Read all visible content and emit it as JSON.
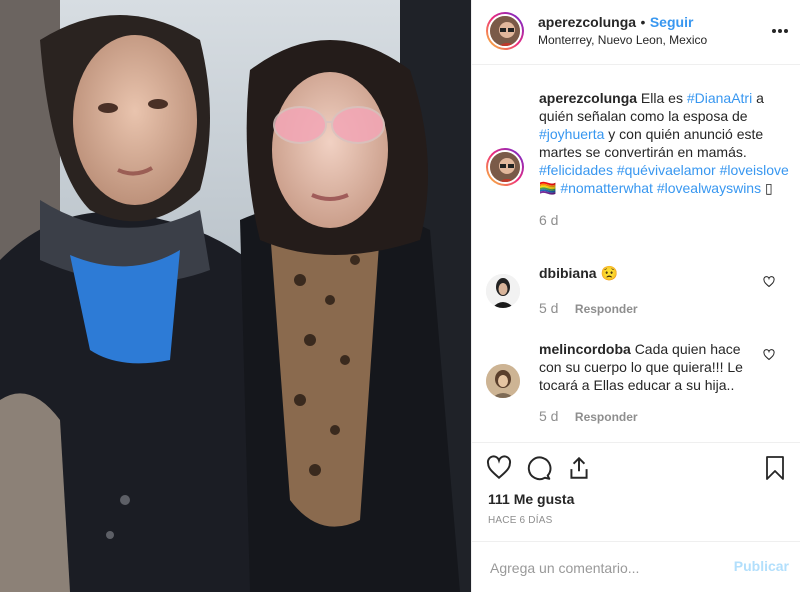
{
  "post": {
    "header": {
      "username": "aperezcolunga",
      "separator": "•",
      "follow_label": "Seguir",
      "location": "Monterrey, Nuevo Leon, Mexico",
      "more_icon": "more-horizontal-icon"
    },
    "caption": {
      "username": "aperezcolunga",
      "text_1": " Ella es ",
      "tag_1": "#DianaAtri",
      "text_2": " a quién señalan como la esposa de ",
      "tag_2": "#joyhuerta",
      "text_3": " y con quién anunció este martes se convertirán en mamás. ",
      "tag_3": "#felicidades",
      "tag_4": "#quévivaelamor",
      "tag_5": "#loveislove",
      "emoji_1": "🏳️‍🌈",
      "tag_6": "#nomatterwhat",
      "tag_7": "#lovealwayswins",
      "emoji_2": "▯",
      "time": "6 d"
    },
    "comments": [
      {
        "username": "dbibiana",
        "text": "😟",
        "time": "5 d",
        "reply_label": "Responder"
      },
      {
        "username": "melincordoba",
        "text": "Cada quien hace con su cuerpo lo que quiera!!! Le tocará a Ellas educar a su hija..",
        "time": "5 d",
        "reply_label": "Responder"
      }
    ],
    "likes": "111 Me gusta",
    "posted_ago": "HACE 6 DÍAS",
    "comment_input": {
      "placeholder": "Agrega un comentario...",
      "publish_label": "Publicar"
    }
  }
}
